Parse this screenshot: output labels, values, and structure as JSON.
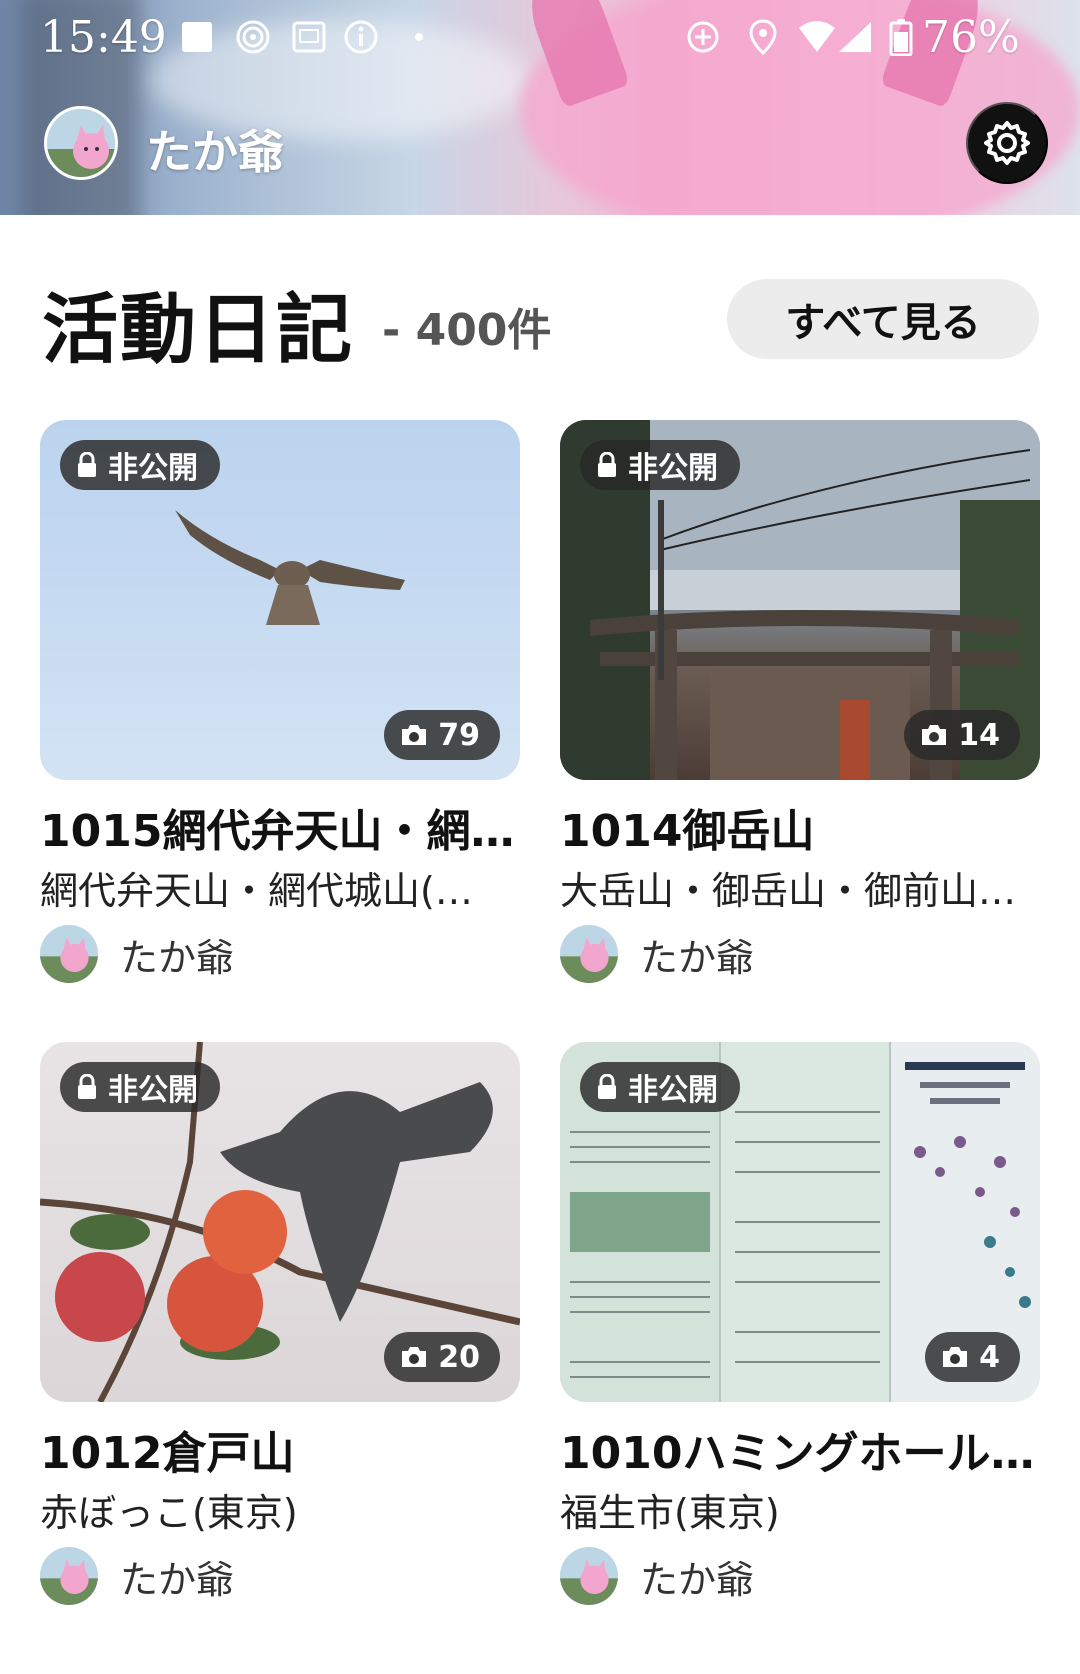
{
  "status_bar": {
    "time": "15:49",
    "battery": "76%",
    "icons": [
      "notification-square-icon",
      "cast-icon",
      "screen-icon",
      "info-icon",
      "dot-icon",
      "sync-icon",
      "location-icon",
      "wifi-icon",
      "signal-icon",
      "battery-icon"
    ]
  },
  "header": {
    "username": "たか爺",
    "settings_icon": "gear-icon"
  },
  "section": {
    "title": "活動日記",
    "count": "- 400件",
    "see_all": "すべて見る"
  },
  "cards": [
    {
      "private_label": "非公開",
      "photo_count": "79",
      "title": "1015網代弁天山・網…",
      "subtitle": "網代弁天山・網代城山(…",
      "author": "たか爺"
    },
    {
      "private_label": "非公開",
      "photo_count": "14",
      "title": "1014御岳山",
      "subtitle": "大岳山・御岳山・御前山…",
      "author": "たか爺"
    },
    {
      "private_label": "非公開",
      "photo_count": "20",
      "title": "1012倉戸山",
      "subtitle": "赤ぼっこ(東京)",
      "author": "たか爺"
    },
    {
      "private_label": "非公開",
      "photo_count": "4",
      "title": "1010ハミングホール…",
      "subtitle": "福生市(東京)",
      "author": "たか爺"
    }
  ]
}
